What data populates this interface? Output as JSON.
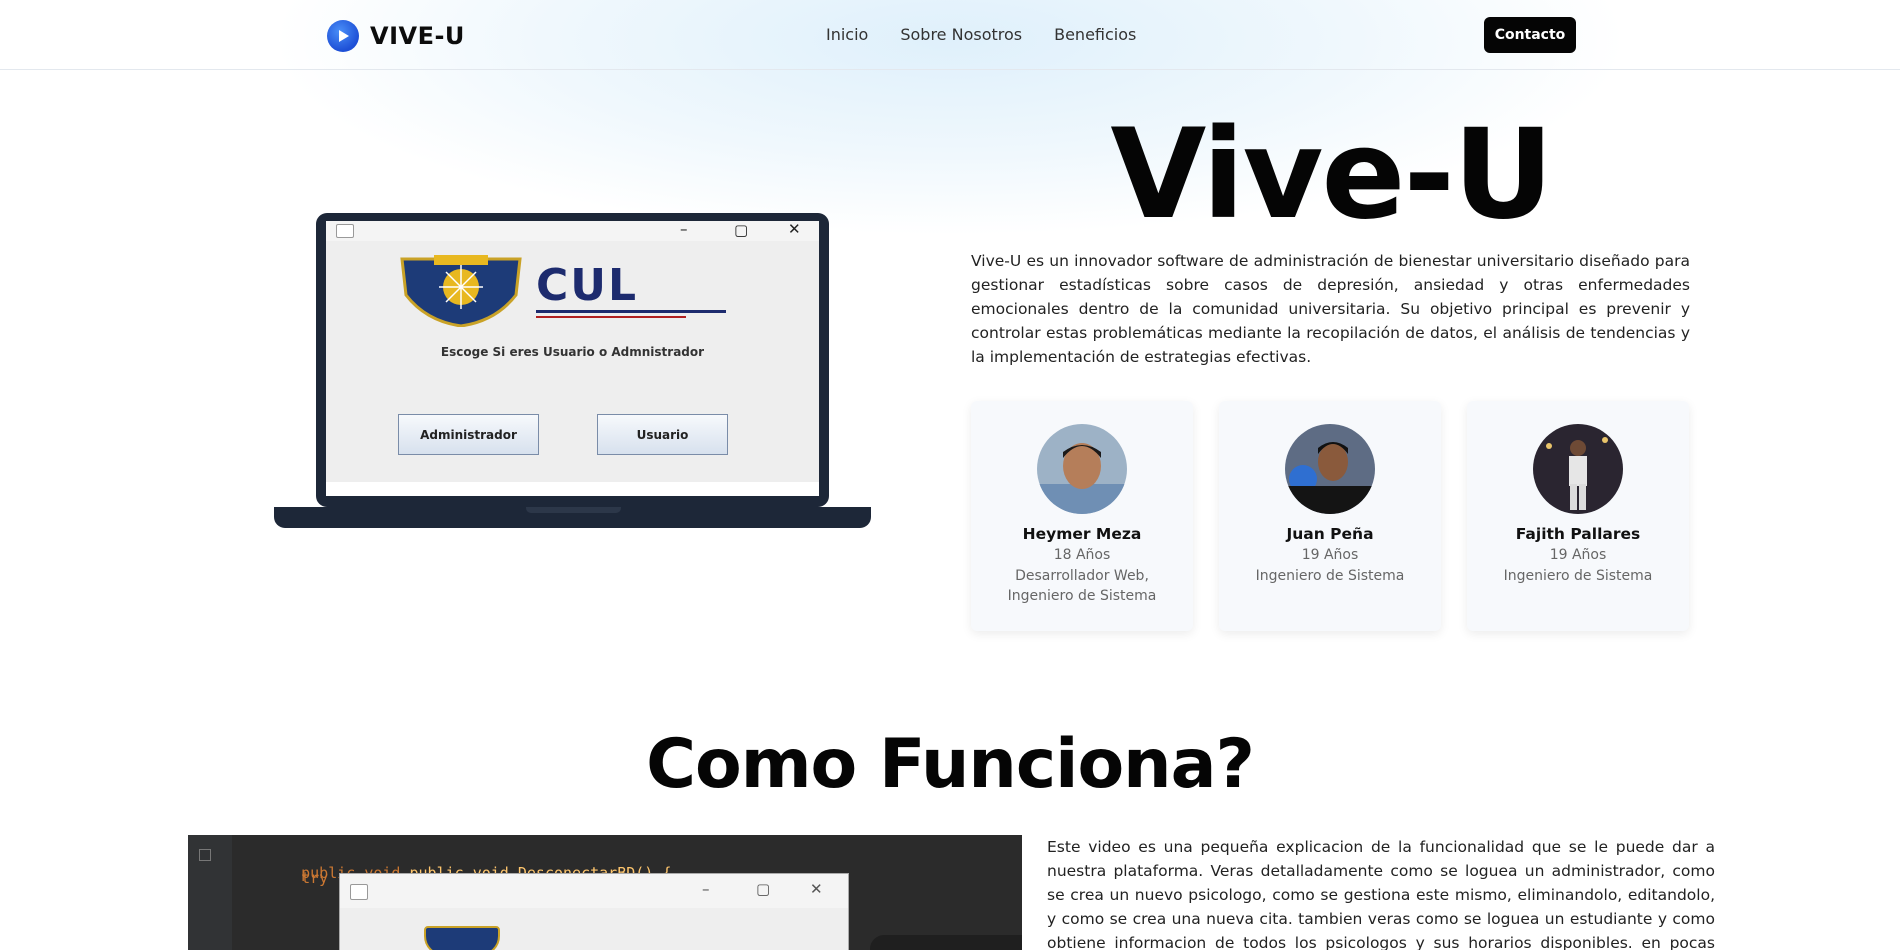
{
  "nav": {
    "brand": "VIVE-U",
    "links": [
      "Inicio",
      "Sobre Nosotros",
      "Beneficios"
    ],
    "contact_label": "Contacto"
  },
  "hero": {
    "title": "Vive-U",
    "description": "Vive-U es un innovador software de administración de bienestar universitario diseñado para gestionar estadísticas sobre casos de depresión, ansiedad y otras enfermedades emocionales dentro de la comunidad universitaria. Su objetivo principal es prevenir y controlar estas problemáticas mediante la recopilación de datos, el análisis de tendencias y la implementación de estrategias efectivas.",
    "app_window": {
      "logo_text": "CUL",
      "prompt": "Escoge Si eres Usuario o Admnistrador",
      "admin_button": "Administrador",
      "user_button": "Usuario"
    }
  },
  "team": [
    {
      "name": "Heymer Meza",
      "age": "18 Años",
      "role": "Desarrollador Web, Ingeniero de Sistema"
    },
    {
      "name": "Juan Peña",
      "age": "19 Años",
      "role": "Ingeniero de Sistema"
    },
    {
      "name": "Fajith Pallares",
      "age": "19 Años",
      "role": "Ingeniero de Sistema"
    }
  ],
  "how": {
    "title": "Como Funciona?",
    "code_line1": "public void DesconectarBD() {",
    "code_line2": "    try",
    "description": "Este video es una pequeña explicacion de la funcionalidad que se le puede dar a nuestra plataforma. Veras detalladamente como se loguea un administrador, como se crea un nuevo psicologo, como se gestiona este mismo, eliminandolo, editandolo, y como se crea una nueva cita. tambien veras como se loguea un estudiante y como obtiene informacion de todos los psicologos y sus horarios disponibles. en pocas palabras veras cada una de las"
  },
  "colors": {
    "accent": "#1d4fd6",
    "dark": "#050505",
    "laptop": "#1d2738"
  }
}
